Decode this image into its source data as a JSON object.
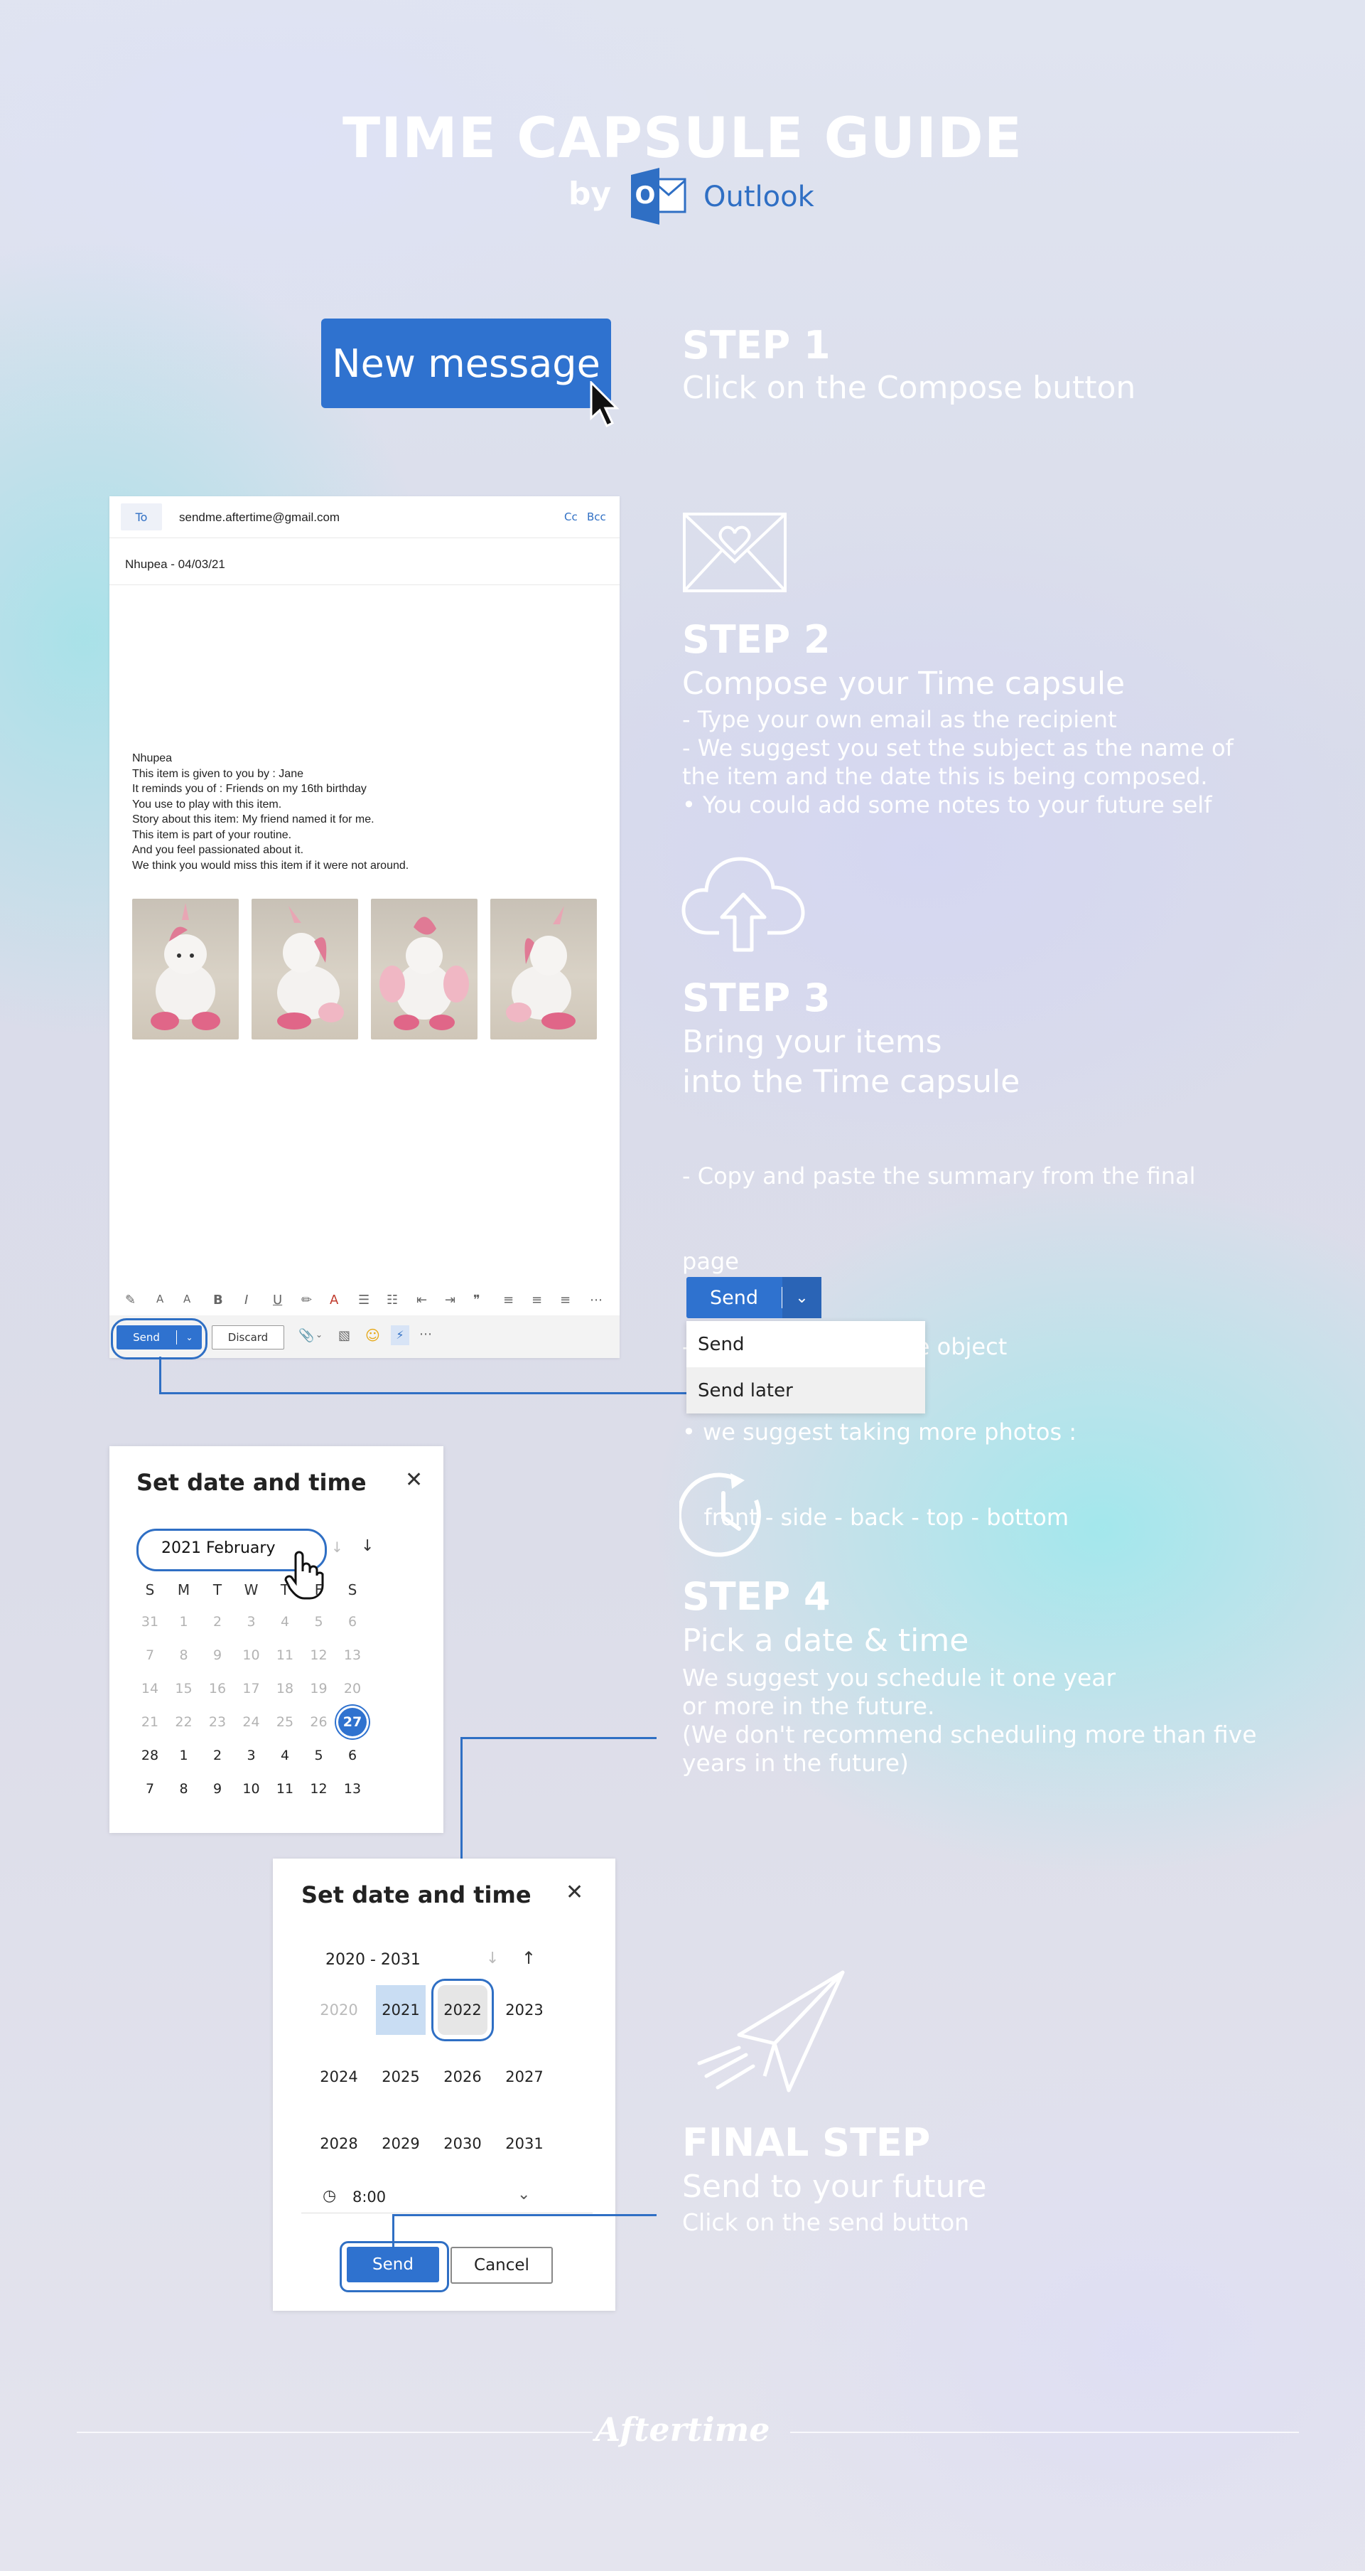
{
  "header": {
    "title": "TIME CAPSULE GUIDE",
    "by": "by",
    "brand": "Outlook"
  },
  "step1": {
    "button_label": "New message",
    "heading": "STEP 1",
    "subtitle": "Click on the Compose button"
  },
  "compose": {
    "to_label": "To",
    "to_value": "sendme.aftertime@gmail.com",
    "cc": "Cc",
    "bcc": "Bcc",
    "subject": "Nhupea - 04/03/21",
    "body_lines": [
      "Nhupea",
      "This item is given to you by : Jane",
      "It reminds you of : Friends on my 16th birthday",
      "You use to play with this item.",
      "Story about this item: My friend named it for me.",
      "This item is part of your routine.",
      "And you feel passionated about it.",
      "We think you would miss this item if it were not around."
    ],
    "send_label": "Send",
    "discard_label": "Discard"
  },
  "step2": {
    "heading": "STEP 2",
    "subtitle": "Compose your Time capsule",
    "lines": [
      "- Type your own email as the recipient",
      "- We suggest you set the subject as the name of",
      "the item and the date this is being composed.",
      "• You could add some notes to your future self"
    ]
  },
  "step3": {
    "heading": "STEP 3",
    "subtitle_1": "Bring your items",
    "subtitle_2": "into the Time capsule",
    "lines": [
      "- Copy and paste the summary from the final",
      "page",
      "- Attach photos of the object",
      "• we suggest taking more photos :",
      "   front - side - back - top - bottom"
    ]
  },
  "send_menu": {
    "button": "Send",
    "items": [
      "Send",
      "Send later"
    ]
  },
  "calendar_dialog": {
    "title": "Set date and time",
    "month": "2021 February",
    "weekdays": [
      "S",
      "M",
      "T",
      "W",
      "T",
      "F",
      "S"
    ],
    "weeks": [
      [
        "31",
        "1",
        "2",
        "3",
        "4",
        "5",
        "6"
      ],
      [
        "7",
        "8",
        "9",
        "10",
        "11",
        "12",
        "13"
      ],
      [
        "14",
        "15",
        "16",
        "17",
        "18",
        "19",
        "20"
      ],
      [
        "21",
        "22",
        "23",
        "24",
        "25",
        "26",
        "27"
      ],
      [
        "28",
        "1",
        "2",
        "3",
        "4",
        "5",
        "6"
      ],
      [
        "7",
        "8",
        "9",
        "10",
        "11",
        "12",
        "13"
      ]
    ],
    "selected": "27"
  },
  "step4": {
    "heading": "STEP 4",
    "subtitle": "Pick a date & time",
    "lines": [
      "We suggest you schedule it one year",
      "or more in the future.",
      "(We don't recommend scheduling more than five",
      "years in the future)"
    ]
  },
  "year_dialog": {
    "title": "Set date and time",
    "range": "2020 - 2031",
    "years": [
      "2020",
      "2021",
      "2022",
      "2023",
      "2024",
      "2025",
      "2026",
      "2027",
      "2028",
      "2029",
      "2030",
      "2031"
    ],
    "time": "8:00",
    "send_label": "Send",
    "cancel_label": "Cancel"
  },
  "final": {
    "heading": "FINAL STEP",
    "subtitle": "Send to your future",
    "note": "Click on the send button"
  },
  "footer": {
    "brand": "Aftertime"
  },
  "colors": {
    "accent": "#2f72cf",
    "text_white": "#ffffff"
  }
}
